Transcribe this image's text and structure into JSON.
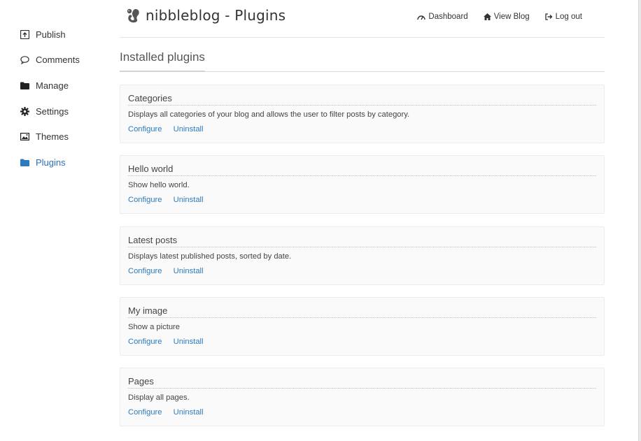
{
  "app": {
    "title": "nibbleblog - Plugins"
  },
  "sidebar": {
    "items": [
      {
        "label": "Publish",
        "icon": "publish-icon"
      },
      {
        "label": "Comments",
        "icon": "comment-icon"
      },
      {
        "label": "Manage",
        "icon": "folder-icon"
      },
      {
        "label": "Settings",
        "icon": "gear-icon"
      },
      {
        "label": "Themes",
        "icon": "image-icon"
      },
      {
        "label": "Plugins",
        "icon": "folder-icon",
        "active": true
      }
    ]
  },
  "topnav": {
    "dashboard": "Dashboard",
    "view_blog": "View Blog",
    "logout": "Log out"
  },
  "section": {
    "title": "Installed plugins"
  },
  "plugins": [
    {
      "name": "Categories",
      "description": "Displays all categories of your blog and allows the user to filter posts by category.",
      "configure": "Configure",
      "uninstall": "Uninstall"
    },
    {
      "name": "Hello world",
      "description": "Show hello world.",
      "configure": "Configure",
      "uninstall": "Uninstall"
    },
    {
      "name": "Latest posts",
      "description": "Displays latest published posts, sorted by date.",
      "configure": "Configure",
      "uninstall": "Uninstall"
    },
    {
      "name": "My image",
      "description": "Show a picture",
      "configure": "Configure",
      "uninstall": "Uninstall"
    },
    {
      "name": "Pages",
      "description": "Display all pages.",
      "configure": "Configure",
      "uninstall": "Uninstall"
    }
  ],
  "colors": {
    "accent": "#2a7bbf",
    "active_nav": "#2a6fb5",
    "panel_bg": "#fafafa"
  }
}
